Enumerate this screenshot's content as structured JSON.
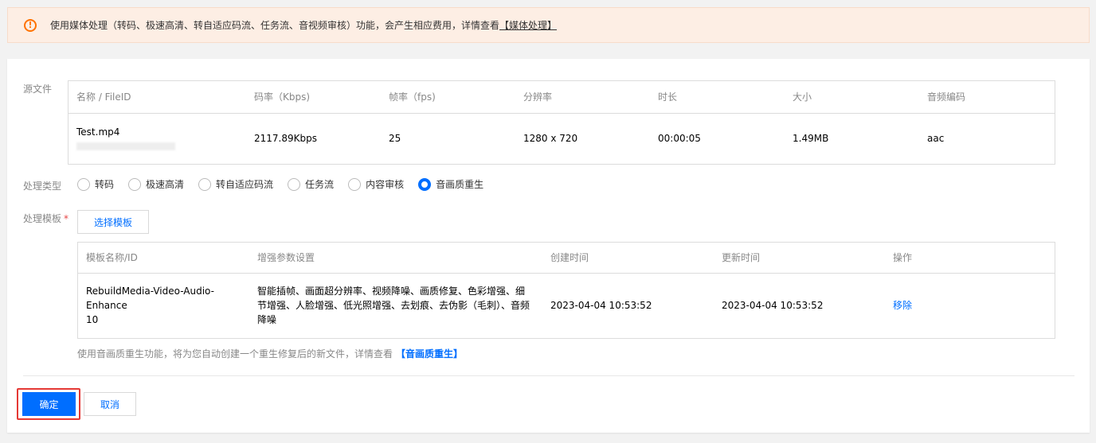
{
  "notice": {
    "text": "使用媒体处理（转码、极速高清、转自适应码流、任务流、音视频审核）功能，会产生相应费用，详情查看",
    "link": "【媒体处理】"
  },
  "source": {
    "label": "源文件",
    "columns": [
      "名称 / FileID",
      "码率（Kbps)",
      "帧率（fps)",
      "分辨率",
      "时长",
      "大小",
      "音频编码"
    ],
    "row": {
      "name": "Test.mp4",
      "bitrate": "2117.89Kbps",
      "fps": "25",
      "resolution": "1280 x 720",
      "duration": "00:00:05",
      "size": "1.49MB",
      "audio": "aac"
    }
  },
  "process_type": {
    "label": "处理类型",
    "options": [
      "转码",
      "极速高清",
      "转自适应码流",
      "任务流",
      "内容审核",
      "音画质重生"
    ],
    "selected": "音画质重生"
  },
  "template": {
    "label": "处理模板",
    "required_mark": "*",
    "select_button": "选择模板",
    "columns": [
      "模板名称/ID",
      "增强参数设置",
      "创建时间",
      "更新时间",
      "操作"
    ],
    "row": {
      "name": "RebuildMedia-Video-Audio-Enhance",
      "id": "10",
      "params": "智能插帧、画面超分辨率、视频降噪、画质修复、色彩增强、细节增强、人脸增强、低光照增强、去划痕、去伪影（毛刺）、音频降噪",
      "created": "2023-04-04 10:53:52",
      "updated": "2023-04-04 10:53:52",
      "action": "移除"
    },
    "hint": "使用音画质重生功能，将为您自动创建一个重生修复后的新文件，详情查看",
    "hint_link": "【音画质重生】"
  },
  "footer": {
    "confirm": "确定",
    "cancel": "取消"
  },
  "colors": {
    "primary": "#006eff",
    "warning": "#ff7200",
    "highlight": "#e53935"
  }
}
